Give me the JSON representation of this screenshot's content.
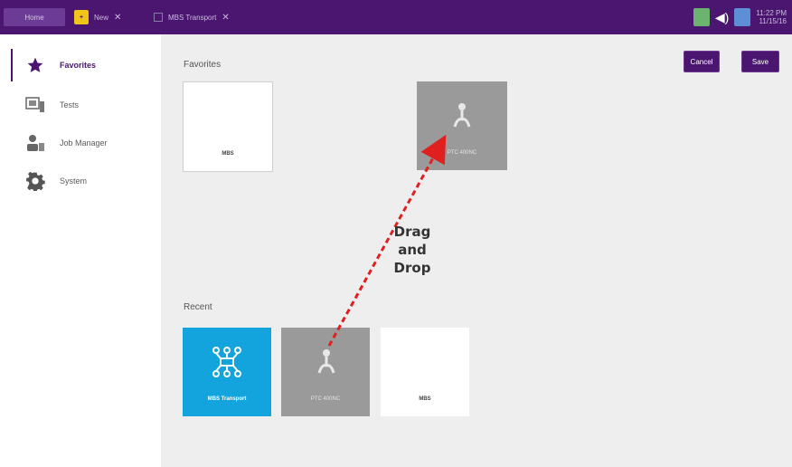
{
  "topbar": {
    "tabs": [
      {
        "label": "Home"
      },
      {
        "label": "New",
        "badge": "+"
      },
      {
        "label": "MBS Transport"
      }
    ],
    "clock": {
      "time": "11:22 PM",
      "date": "11/15/16"
    }
  },
  "sidebar": {
    "items": [
      {
        "label": "Favorites",
        "icon": "star-icon",
        "active": true
      },
      {
        "label": "Tests",
        "icon": "tests-icon"
      },
      {
        "label": "Job Manager",
        "icon": "job-manager-icon"
      },
      {
        "label": "System",
        "icon": "gear-icon"
      }
    ]
  },
  "main": {
    "favorites_title": "Favorites",
    "recent_title": "Recent",
    "cancel_label": "Cancel",
    "save_label": "Save",
    "favorites_tiles": [
      {
        "label": "MBS",
        "style": "white"
      },
      {
        "label": "PTC 400NC",
        "style": "gray",
        "icon": "plug-icon"
      }
    ],
    "recent_tiles": [
      {
        "label": "MBS Transport",
        "style": "blue",
        "icon": "network-icon"
      },
      {
        "label": "PTC 400NC",
        "style": "gray",
        "icon": "plug-icon"
      },
      {
        "label": "MBS",
        "style": "white"
      }
    ],
    "annotation": {
      "line1": "Drag",
      "line2": "and",
      "line3": "Drop"
    }
  },
  "colors": {
    "accent": "#4a1670",
    "tile_blue": "#13a4dd",
    "tile_gray": "#9a9a9a",
    "arrow": "#e02020"
  }
}
